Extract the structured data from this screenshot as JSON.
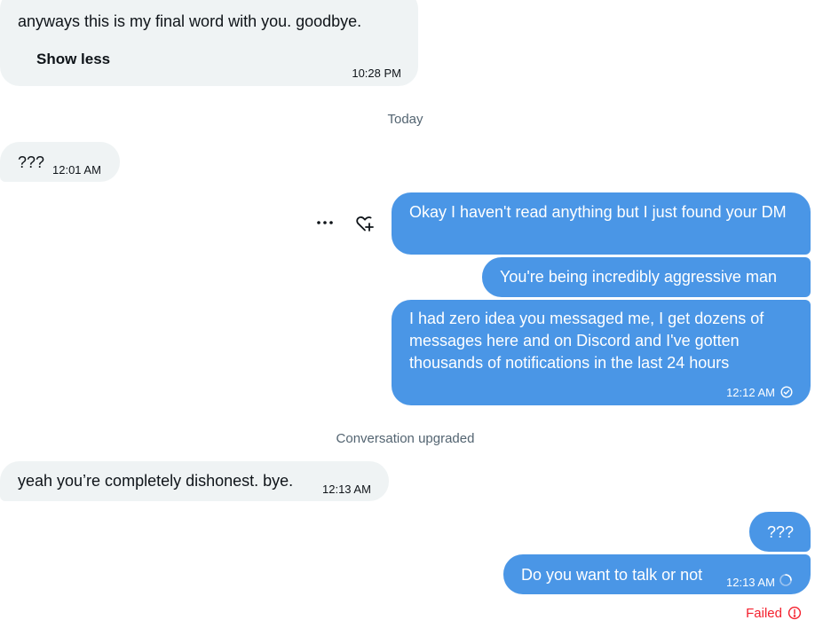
{
  "messages": {
    "m1": {
      "text": "anyways this is my final word with you. goodbye.",
      "show_less": "Show less",
      "time": "10:28 PM"
    },
    "m2": {
      "text": "???",
      "time": "12:01 AM"
    },
    "m3": {
      "text": "Okay I haven't read anything but I just found your DM"
    },
    "m4": {
      "text": "You're being incredibly aggressive man"
    },
    "m5": {
      "text": "I had zero idea you messaged me, I get dozens of messages here and on Discord and I've gotten thousands of notifications in the last 24 hours",
      "time": "12:12 AM"
    },
    "m6": {
      "text": "yeah you’re completely dishonest. bye.",
      "time": "12:13 AM"
    },
    "m7": {
      "text": "???"
    },
    "m8": {
      "text": "Do you want to talk or not",
      "time": "12:13 AM"
    }
  },
  "dividers": {
    "today": "Today",
    "upgraded": "Conversation upgraded"
  },
  "status": {
    "failed": "Failed"
  },
  "icons": {
    "more": "more-horizontal-icon",
    "react": "heart-plus-icon",
    "read": "check-circle-icon",
    "sending": "spinner-icon",
    "error": "error-info-icon"
  },
  "colors": {
    "sent_bubble": "#4a96e6",
    "received_bubble": "#eff3f4",
    "muted_text": "#536471",
    "failed_red": "#f4212e"
  }
}
